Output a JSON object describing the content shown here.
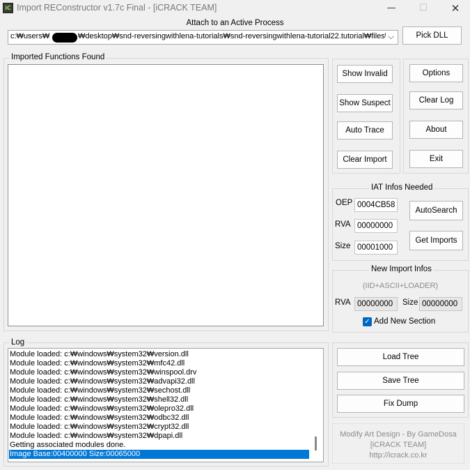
{
  "window": {
    "icon_text": "iC",
    "title": "Import REConstructor v1.7c Final - [iCRACK TEAM]",
    "min_glyph": "—",
    "max_glyph": "☐",
    "close_glyph": "✕"
  },
  "process": {
    "group_label": "Attach to an Active Process",
    "path": "c:₩users₩",
    "path_rest": "₩desktop₩snd-reversingwithlena-tutorials₩snd-reversingwithlena-tutorial22.tutorial₩files₩",
    "pick_dll": "Pick DLL",
    "dropdown_glyph": "⌵"
  },
  "imported": {
    "group_label": "Imported Functions Found"
  },
  "buttons": {
    "show_invalid": "Show Invalid",
    "show_suspect": "Show Suspect",
    "auto_trace": "Auto Trace",
    "clear_import": "Clear Import",
    "options": "Options",
    "clear_log": "Clear Log",
    "about": "About",
    "exit": "Exit"
  },
  "iat": {
    "group_label": "IAT Infos Needed",
    "oep_label": "OEP",
    "oep_value": "0004CB58",
    "rva_label": "RVA",
    "rva_value": "00000000",
    "size_label": "Size",
    "size_value": "00001000",
    "autosearch": "AutoSearch",
    "get_imports": "Get Imports"
  },
  "new_import": {
    "group_label": "New Import Infos",
    "subtitle": "(IID+ASCII+LOADER)",
    "rva_label": "RVA",
    "rva_value": "00000000",
    "size_label": "Size",
    "size_value": "00000000",
    "add_section_label": "Add New Section",
    "add_section_checked": true
  },
  "log": {
    "group_label": "Log",
    "lines": [
      "Module loaded: c:₩windows₩system32₩version.dll",
      "Module loaded: c:₩windows₩system32₩mfc42.dll",
      "Module loaded: c:₩windows₩system32₩winspool.drv",
      "Module loaded: c:₩windows₩system32₩advapi32.dll",
      "Module loaded: c:₩windows₩system32₩sechost.dll",
      "Module loaded: c:₩windows₩system32₩shell32.dll",
      "Module loaded: c:₩windows₩system32₩olepro32.dll",
      "Module loaded: c:₩windows₩system32₩odbc32.dll",
      "Module loaded: c:₩windows₩system32₩crypt32.dll",
      "Module loaded: c:₩windows₩system32₩dpapi.dll",
      "Getting associated modules done.",
      "Image Base:00400000 Size:00065000"
    ],
    "selected_index": 11
  },
  "tree": {
    "load_tree": "Load Tree",
    "save_tree": "Save Tree",
    "fix_dump": "Fix Dump"
  },
  "credits": {
    "line1": "Modify Art Design - By GameDosa",
    "line2": "[iCRACK TEAM]",
    "line3": "http://icrack.co.kr"
  }
}
